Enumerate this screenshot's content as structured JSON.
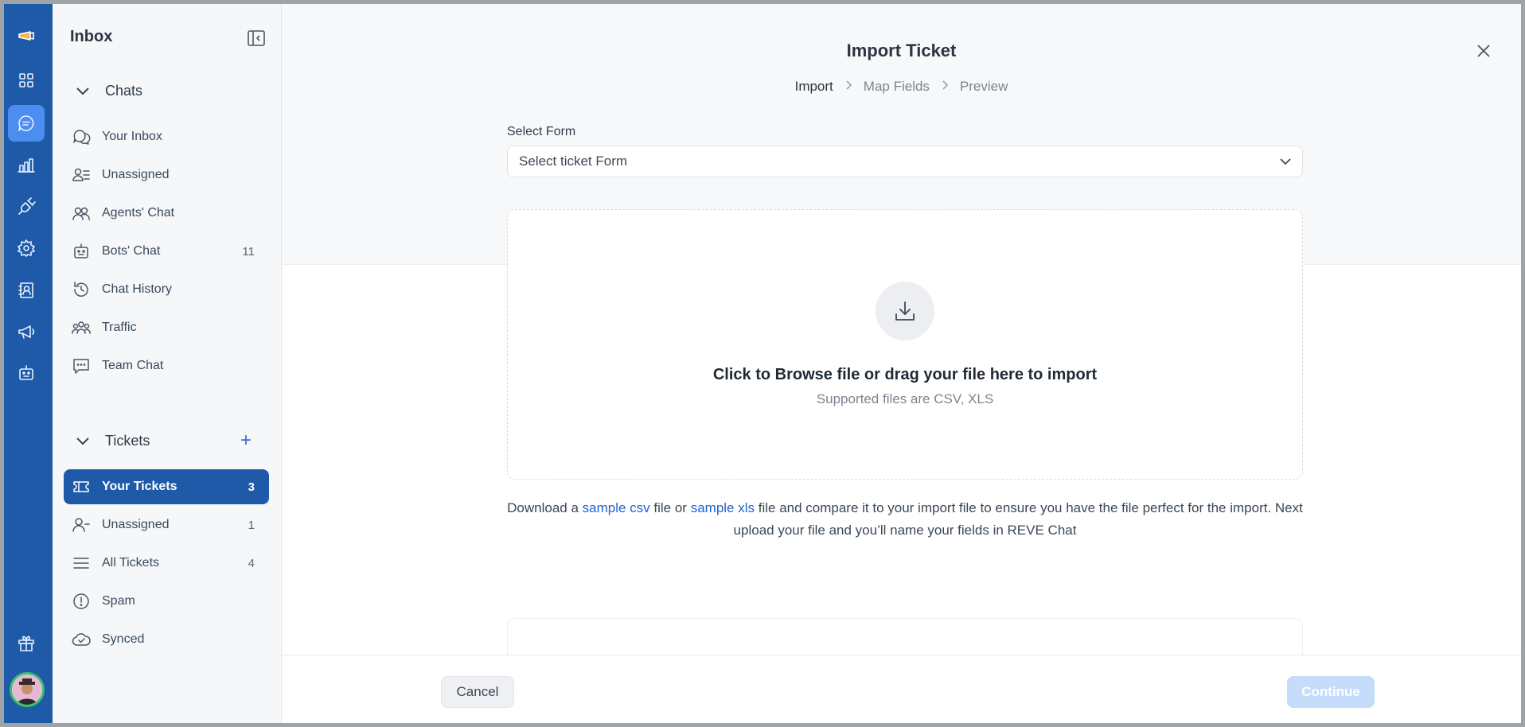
{
  "rail": {
    "items": [
      {
        "icon": "logo-icon"
      },
      {
        "icon": "dashboard-icon"
      },
      {
        "icon": "chat-icon",
        "active": true
      },
      {
        "icon": "analytics-icon"
      },
      {
        "icon": "integrations-icon"
      },
      {
        "icon": "settings-icon"
      },
      {
        "icon": "contacts-icon"
      },
      {
        "icon": "campaign-icon"
      },
      {
        "icon": "bot-icon"
      },
      {
        "icon": "gift-icon"
      }
    ]
  },
  "sidebar": {
    "title": "Inbox",
    "chats_section": {
      "label": "Chats",
      "items": [
        {
          "label": "Your Inbox",
          "icon": "chat-bubbles-icon",
          "count": ""
        },
        {
          "label": "Unassigned",
          "icon": "user-list-icon",
          "count": ""
        },
        {
          "label": "Agents' Chat",
          "icon": "agents-icon",
          "count": ""
        },
        {
          "label": "Bots' Chat",
          "icon": "bot-icon",
          "count": "11"
        },
        {
          "label": "Chat History",
          "icon": "history-icon",
          "count": ""
        },
        {
          "label": "Traffic",
          "icon": "traffic-icon",
          "count": ""
        },
        {
          "label": "Team Chat",
          "icon": "team-chat-icon",
          "count": ""
        }
      ]
    },
    "tickets_section": {
      "label": "Tickets",
      "add_symbol": "+",
      "items": [
        {
          "label": "Your Tickets",
          "icon": "ticket-icon",
          "count": "3",
          "active": true
        },
        {
          "label": "Unassigned",
          "icon": "user-minus-icon",
          "count": "1"
        },
        {
          "label": "All Tickets",
          "icon": "list-icon",
          "count": "4"
        },
        {
          "label": "Spam",
          "icon": "alert-circle-icon",
          "count": ""
        },
        {
          "label": "Synced",
          "icon": "cloud-check-icon",
          "count": ""
        }
      ]
    }
  },
  "modal": {
    "title": "Import Ticket",
    "steps": [
      "Import",
      "Map Fields",
      "Preview"
    ],
    "active_step": "Import",
    "form_label": "Select Form",
    "form_placeholder": "Select ticket Form",
    "dropzone": {
      "main": "Click to Browse file or drag your file here to import",
      "sub": "Supported files are CSV, XLS"
    },
    "help": {
      "part1": "Download a ",
      "link_csv": "sample csv",
      "part2": " file or ",
      "link_xls": "sample xls",
      "part3": " file and compare it to your import file to ensure you have the file perfect for the import. Next upload your file and you’ll name your fields in REVE Chat"
    },
    "cancel_label": "Cancel",
    "continue_label": "Continue"
  },
  "colors": {
    "rail": "#1e5aa8",
    "active_nav": "#1e5aa8",
    "link": "#1e62d0",
    "continue_disabled": "#c5dcfb"
  }
}
